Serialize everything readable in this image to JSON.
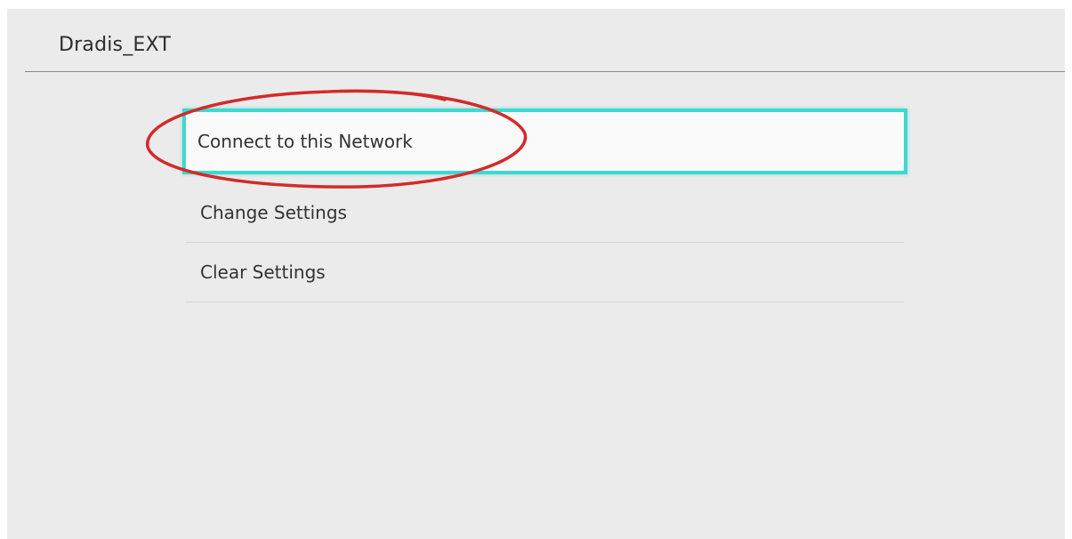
{
  "network": {
    "name": "Dradis_EXT"
  },
  "menu": {
    "items": [
      {
        "label": "Connect to this Network",
        "selected": true
      },
      {
        "label": "Change Settings",
        "selected": false
      },
      {
        "label": "Clear Settings",
        "selected": false
      }
    ]
  },
  "colors": {
    "background": "#ebebeb",
    "selection_border": "#3fd8cf",
    "annotation": "#d42a2a",
    "text": "#333333"
  }
}
